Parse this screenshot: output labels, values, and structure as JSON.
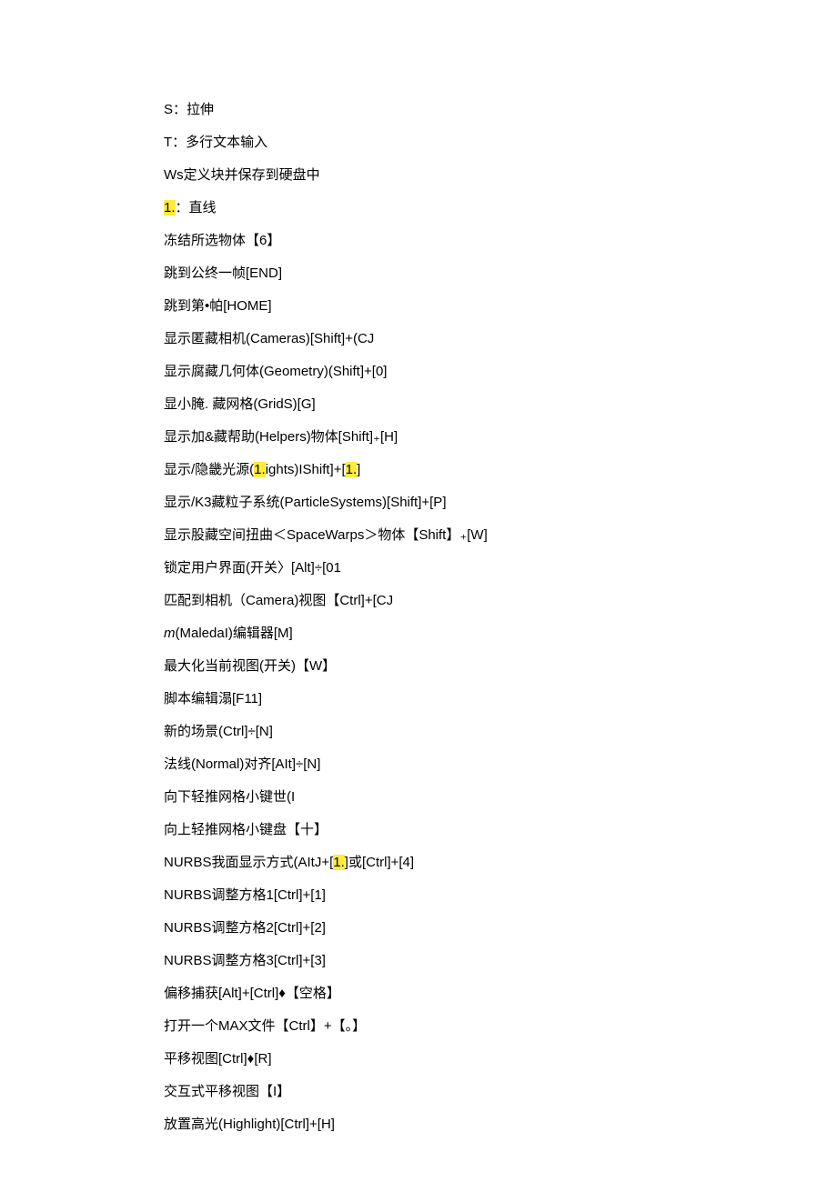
{
  "lines": [
    {
      "parts": [
        {
          "t": "S：拉伸"
        }
      ]
    },
    {
      "parts": [
        {
          "t": "T：多行文本输入"
        }
      ]
    },
    {
      "parts": [
        {
          "t": "Ws定义块并保存到硬盘中"
        }
      ]
    },
    {
      "parts": [
        {
          "t": "1.",
          "hl": true
        },
        {
          "t": "：直线"
        }
      ]
    },
    {
      "parts": [
        {
          "t": "冻结所选物体【6】"
        }
      ]
    },
    {
      "parts": [
        {
          "t": "跳到公终一帧[END]"
        }
      ]
    },
    {
      "parts": [
        {
          "t": "跳到第•帕[HOME]"
        }
      ]
    },
    {
      "parts": [
        {
          "t": "显示匿藏相机(Cameras)[Shift]+(CJ"
        }
      ]
    },
    {
      "parts": [
        {
          "t": "显示腐藏几何体(Geometry)(Shift]+[0]"
        }
      ]
    },
    {
      "parts": [
        {
          "t": "显小腌. 藏网格(GridS)[G]"
        }
      ]
    },
    {
      "parts": [
        {
          "t": "显示加&藏帮助(Helpers)物体[Shift]₊[H]"
        }
      ]
    },
    {
      "parts": [
        {
          "t": "显示/隐畿光源("
        },
        {
          "t": "1.",
          "hl": true
        },
        {
          "t": "ights)IShift]+["
        },
        {
          "t": "1.",
          "hl": true
        },
        {
          "t": "]"
        }
      ]
    },
    {
      "parts": [
        {
          "t": "显示/K3藏粒子系统(ParticleSystems)[Shift]+[P]"
        }
      ]
    },
    {
      "parts": [
        {
          "t": "显示股藏空间扭曲＜SpaceWarps＞物体【Shift】₊[W]"
        }
      ]
    },
    {
      "parts": [
        {
          "t": "锁定用户界面(开关〉[Alt]÷[01"
        }
      ]
    },
    {
      "parts": [
        {
          "t": "匹配到相机（Camera)视图【Ctrl]+[CJ"
        }
      ]
    },
    {
      "parts": [
        {
          "t": "m",
          "italic": true
        },
        {
          "t": "(MaledaI)编辑器[M]"
        }
      ]
    },
    {
      "parts": [
        {
          "t": "最大化当前视图(开关)【W】"
        }
      ]
    },
    {
      "parts": [
        {
          "t": "脚本编辑溻[F11]"
        }
      ]
    },
    {
      "parts": [
        {
          "t": "新的场景(Ctrl]÷[N]"
        }
      ]
    },
    {
      "parts": [
        {
          "t": "法线(Normal)对齐[AIt]÷[N]"
        }
      ]
    },
    {
      "parts": [
        {
          "t": "向下轻推网格小键世(I"
        }
      ]
    },
    {
      "parts": [
        {
          "t": "向上轻推网格小键盘【十】"
        }
      ]
    },
    {
      "parts": [
        {
          "t": "NURBS我面显示方式(AItJ+["
        },
        {
          "t": "1.",
          "hl": true
        },
        {
          "t": "]或[Ctrl]+[4]"
        }
      ]
    },
    {
      "parts": [
        {
          "t": "NURBS调整方格1[Ctrl]+[1]"
        }
      ]
    },
    {
      "parts": [
        {
          "t": "NURBS调整方格2[Ctrl]+[2]"
        }
      ]
    },
    {
      "parts": [
        {
          "t": "NURBS调整方格3[Ctrl]+[3]"
        }
      ]
    },
    {
      "parts": [
        {
          "t": "偏移捕获[Alt]+[Ctrl]♦【空格】"
        }
      ]
    },
    {
      "parts": [
        {
          "t": "打开一个MAX文件【Ctrl】+【。】"
        }
      ]
    },
    {
      "parts": [
        {
          "t": "平移视图[Ctrl]♦[R]"
        }
      ]
    },
    {
      "parts": [
        {
          "t": "交互式平移视图【I】"
        }
      ]
    },
    {
      "parts": [
        {
          "t": "放置高光(Highlight)[Ctrl]+[H]"
        }
      ]
    }
  ]
}
